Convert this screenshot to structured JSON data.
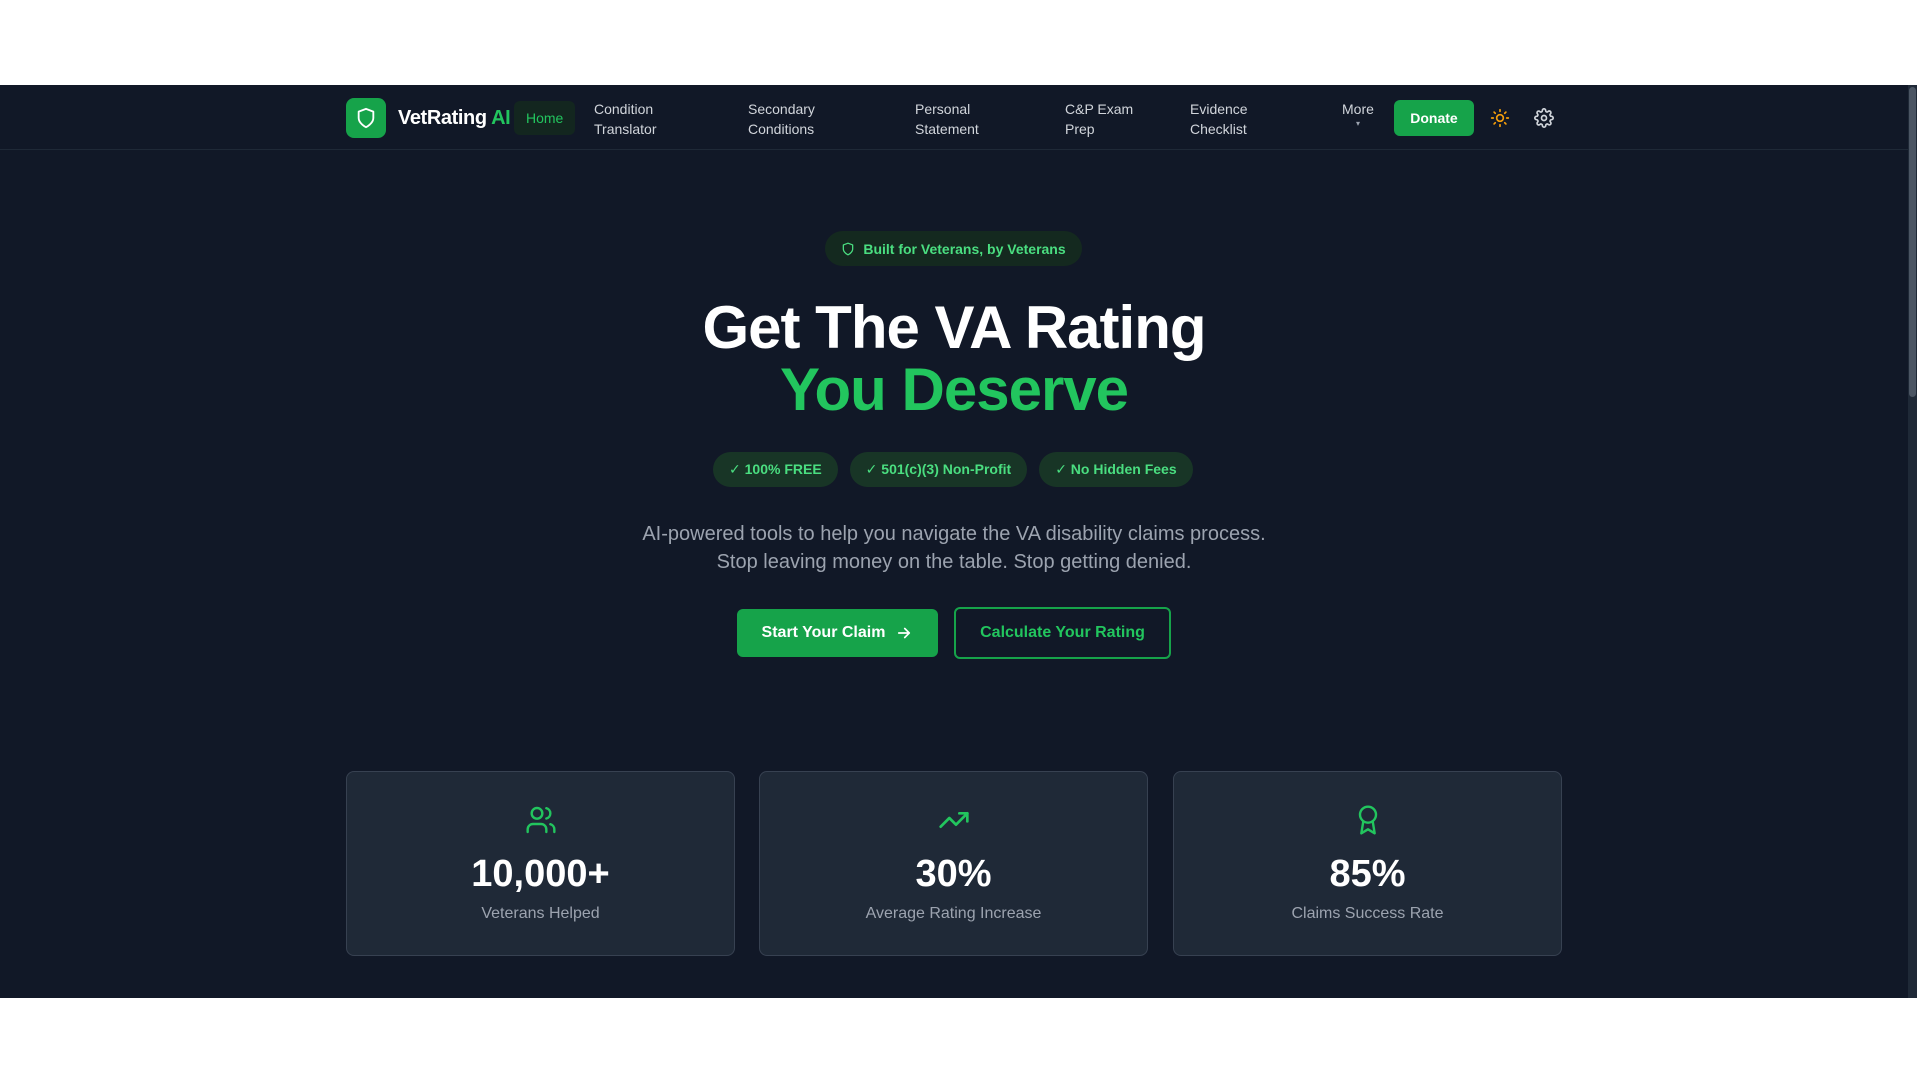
{
  "header": {
    "logo": {
      "text": "VetRating ",
      "accent": "AI"
    },
    "nav": {
      "home": "Home",
      "items": [
        {
          "line1": "Condition",
          "line2": "Translator"
        },
        {
          "line1": "Secondary",
          "line2": "Conditions"
        },
        {
          "line1": "Personal",
          "line2": "Statement"
        },
        {
          "line1": "C&P Exam",
          "line2": "Prep"
        },
        {
          "line1": "Evidence",
          "line2": "Checklist"
        }
      ],
      "more": "More",
      "more_caret": "▾"
    },
    "donate": "Donate",
    "icons": {
      "theme": "sun-icon",
      "settings": "gear-icon"
    }
  },
  "hero": {
    "badge": "Built for Veterans, by Veterans",
    "title_line1": "Get The VA Rating",
    "title_line2": "You Deserve",
    "pills": [
      "✓ 100% FREE",
      "✓ 501(c)(3) Non-Profit",
      "✓ No Hidden Fees"
    ],
    "subtitle_line1": "AI-powered tools to help you navigate the VA disability claims process.",
    "subtitle_line2": "Stop leaving money on the table. Stop getting denied.",
    "cta_primary": "Start Your Claim",
    "cta_secondary": "Calculate Your Rating"
  },
  "stats": [
    {
      "icon": "users-icon",
      "value": "10,000+",
      "label": "Veterans Helped"
    },
    {
      "icon": "trending-up-icon",
      "value": "30%",
      "label": "Average Rating Increase"
    },
    {
      "icon": "award-icon",
      "value": "85%",
      "label": "Claims Success Rate"
    }
  ],
  "colors": {
    "background": "#111827",
    "card": "#1f2937",
    "accent": "#22c55e",
    "button": "#16a34a",
    "sun": "#f59e0b"
  }
}
